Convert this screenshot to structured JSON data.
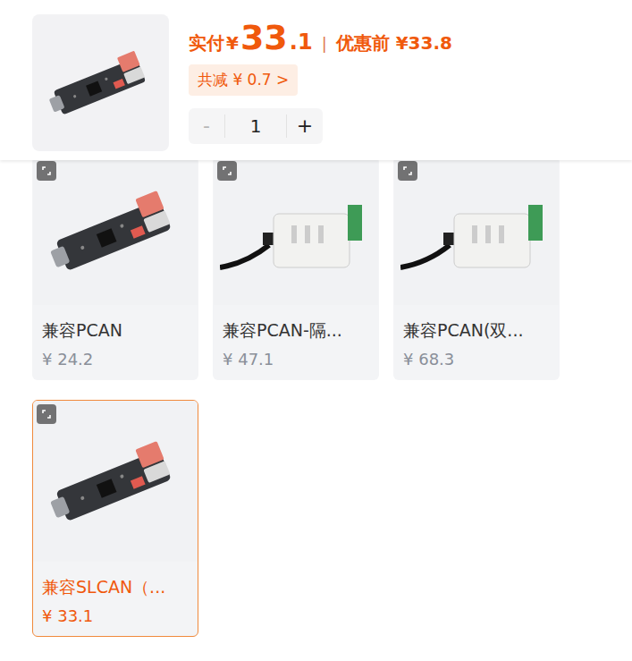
{
  "header": {
    "price_label": "实付",
    "currency": "¥",
    "price_int": "33",
    "price_dec": ".1",
    "divider": "|",
    "original_price": "优惠前 ¥33.8",
    "discount": "共减 ¥ 0.7 >"
  },
  "quantity": {
    "minus": "-",
    "value": "1",
    "plus": "+",
    "minus_disabled": true
  },
  "options": [
    {
      "label": "兼容PCAN",
      "price": "¥ 24.2",
      "selected": false,
      "kind": "board"
    },
    {
      "label": "兼容PCAN-隔...",
      "price": "¥ 47.1",
      "selected": false,
      "kind": "box"
    },
    {
      "label": "兼容PCAN(双...",
      "price": "¥ 68.3",
      "selected": false,
      "kind": "box"
    },
    {
      "label": "兼容SLCAN（...",
      "price": "¥ 33.1",
      "selected": true,
      "kind": "board"
    }
  ]
}
